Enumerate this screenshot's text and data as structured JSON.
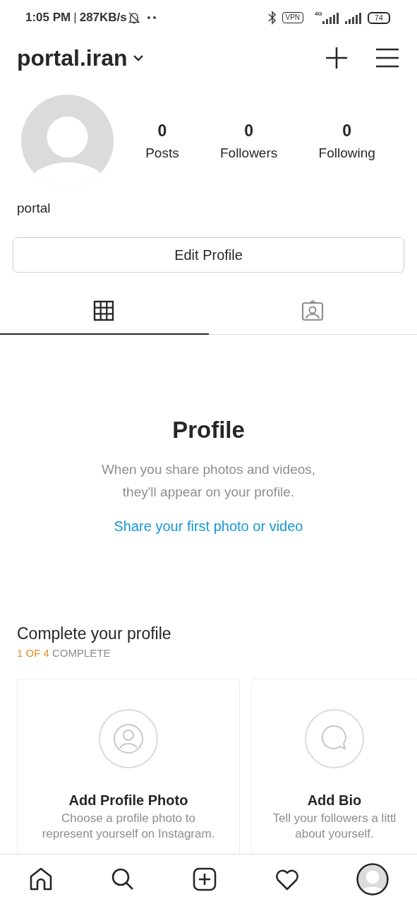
{
  "status_bar": {
    "time": "1:05 PM",
    "separator": "|",
    "speed": "287KB/s",
    "vpn": "VPN",
    "network": "4G",
    "battery": "74"
  },
  "header": {
    "username": "portal.iran"
  },
  "stats": [
    {
      "value": "0",
      "label": "Posts"
    },
    {
      "value": "0",
      "label": "Followers"
    },
    {
      "value": "0",
      "label": "Following"
    }
  ],
  "display_name": "portal",
  "edit_button": "Edit Profile",
  "tabs": [
    {
      "kind": "grid",
      "selected": true
    },
    {
      "kind": "tagged",
      "selected": false
    }
  ],
  "empty_state": {
    "title": "Profile",
    "text": "When you share photos and videos,\nthey'll appear on your profile.",
    "link": "Share your first photo or video"
  },
  "complete_profile": {
    "title": "Complete your profile",
    "progress": "1 OF 4",
    "progress_suffix": "COMPLETE",
    "cards": [
      {
        "kind": "photo",
        "title": "Add Profile Photo",
        "text": "Choose a profile photo to\nrepresent yourself on Instagram."
      },
      {
        "kind": "bio",
        "title": "Add Bio",
        "text": "Tell your followers a littl\nabout yourself."
      }
    ]
  },
  "bottom_nav": [
    {
      "kind": "home"
    },
    {
      "kind": "search"
    },
    {
      "kind": "add"
    },
    {
      "kind": "activity"
    },
    {
      "kind": "profile"
    }
  ]
}
